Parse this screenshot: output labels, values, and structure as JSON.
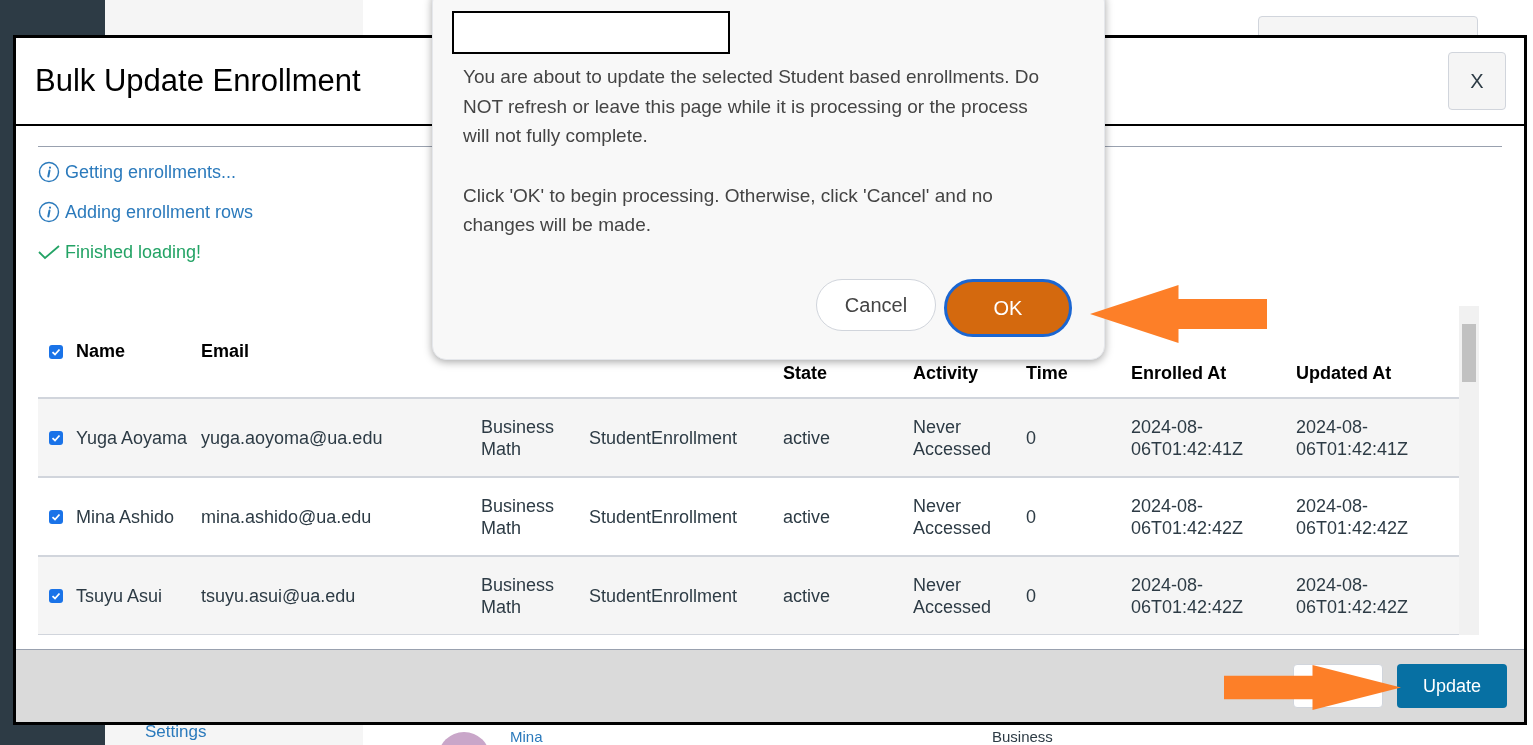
{
  "background": {
    "nav_link": "Settings",
    "student_name": "Mina",
    "course": "Business"
  },
  "modal": {
    "title": "Bulk Update Enrollment",
    "close": "X",
    "messages": [
      {
        "kind": "info",
        "text": "Getting enrollments..."
      },
      {
        "kind": "info",
        "text": "Adding enrollment rows"
      },
      {
        "kind": "success",
        "text": "Finished loading!"
      }
    ],
    "table": {
      "select_all": {
        "checked": true
      },
      "columns": [
        {
          "kind": "label",
          "label": "Name"
        },
        {
          "kind": "label",
          "label": "Email"
        },
        {
          "kind": "hidden"
        },
        {
          "kind": "hidden"
        },
        {
          "kind": "label",
          "label": "State"
        },
        {
          "kind": "label",
          "label": "Activity"
        },
        {
          "kind": "label",
          "label": "Time"
        },
        {
          "kind": "label",
          "label": "Enrolled At"
        },
        {
          "kind": "label",
          "label": "Updated At"
        }
      ],
      "rows": [
        {
          "checked": true,
          "cells": [
            "Yuga Aoyama",
            "yuga.aoyoma@ua.edu",
            "Business Math",
            "StudentEnrollment",
            "active",
            "Never Accessed",
            "0",
            "2024-08-06T01:42:41Z",
            "2024-08-06T01:42:41Z"
          ]
        },
        {
          "checked": true,
          "cells": [
            "Mina Ashido",
            "mina.ashido@ua.edu",
            "Business Math",
            "StudentEnrollment",
            "active",
            "Never Accessed",
            "0",
            "2024-08-06T01:42:42Z",
            "2024-08-06T01:42:42Z"
          ]
        },
        {
          "checked": true,
          "cells": [
            "Tsuyu Asui",
            "tsuyu.asui@ua.edu",
            "Business Math",
            "StudentEnrollment",
            "active",
            "Never Accessed",
            "0",
            "2024-08-06T01:42:42Z",
            "2024-08-06T01:42:42Z"
          ]
        }
      ]
    },
    "footer": {
      "button": "Update"
    }
  },
  "confirm": {
    "paragraphs": [
      "You are about to update the selected Student based enrollments. Do NOT refresh or leave this page while it is processing or the process will not fully complete.",
      "Click 'OK' to begin processing. Otherwise, click 'Cancel' and no changes will be made."
    ],
    "cancel": "Cancel",
    "ok": "OK"
  }
}
